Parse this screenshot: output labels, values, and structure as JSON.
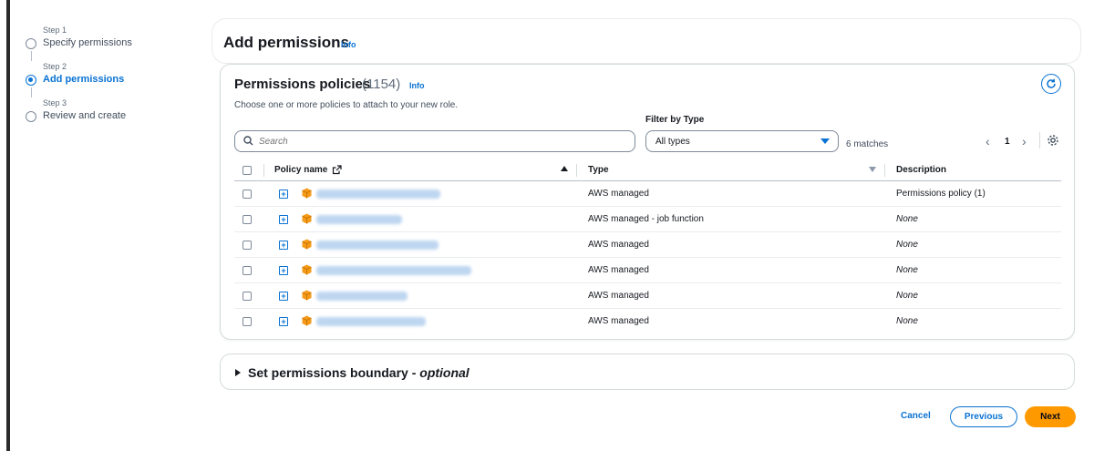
{
  "steps": [
    {
      "small": "Step 1",
      "name": "Specify permissions",
      "active": false
    },
    {
      "small": "Step 2",
      "name": "Add permissions",
      "active": true
    },
    {
      "small": "Step 3",
      "name": "Review and create",
      "active": false
    }
  ],
  "header": {
    "title": "Add permissions",
    "info": "Info"
  },
  "policies": {
    "title": "Permissions policies",
    "count": "(1154)",
    "info": "Info",
    "description": "Choose one or more policies to attach to your new role.",
    "filter_label": "Filter by Type",
    "search_placeholder": "Search",
    "filter_value": "All types",
    "matches": "6 matches",
    "page": "1",
    "columns": {
      "name": "Policy name",
      "type": "Type",
      "description": "Description"
    },
    "rows": [
      {
        "type": "AWS managed",
        "description": "Permissions policy (1)"
      },
      {
        "type": "AWS managed - job function",
        "description": "None"
      },
      {
        "type": "AWS managed",
        "description": "None"
      },
      {
        "type": "AWS managed",
        "description": "None"
      },
      {
        "type": "AWS managed",
        "description": "None"
      },
      {
        "type": "AWS managed",
        "description": "None"
      }
    ]
  },
  "boundary": {
    "label": "Set permissions boundary - ",
    "optional": "optional"
  },
  "buttons": {
    "cancel": "Cancel",
    "previous": "Previous",
    "next": "Next"
  },
  "colors": {
    "accent": "#0972d3",
    "primary_button": "#ff9900",
    "policy_icon": "#f59b1a"
  },
  "icons": {
    "search": "search-icon",
    "refresh": "refresh-icon",
    "settings": "gear-icon",
    "external": "external-link-icon",
    "policy": "aws-cube-icon",
    "expand": "expand-plus-icon"
  }
}
